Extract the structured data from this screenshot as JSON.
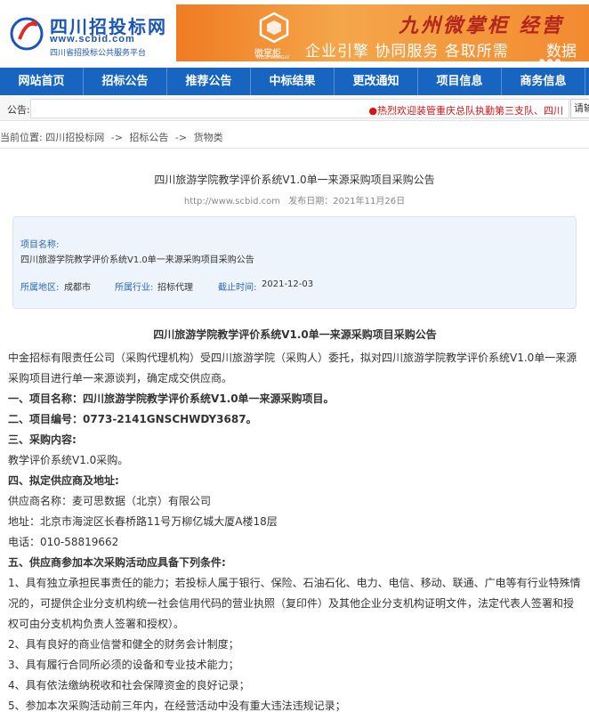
{
  "header": {
    "logo_title": "四川招投标网",
    "logo_url": "www.scbid.com",
    "logo_sub": "四川省招投标公共服务平台"
  },
  "banner": {
    "brand": "微掌柜",
    "brand_en": "WEIZHANGGUI",
    "title": "九州微掌柜  经营",
    "slogan": "企业引擎 协同服务 各取所需",
    "slogan2": "数据天"
  },
  "nav": {
    "items": [
      "网站首页",
      "招标公告",
      "推荐公告",
      "中标结果",
      "更改通知",
      "项目信息",
      "商务信息"
    ]
  },
  "notice": {
    "label": "公告:",
    "text": "●热烈欢迎装管重庆总队执勤第三支队、四川",
    "search_placeholder": "请输"
  },
  "breadcrumb": {
    "prefix": "当前位置:",
    "items": [
      "四川招投标网",
      "招标公告",
      "货物类"
    ],
    "sep": "->"
  },
  "article": {
    "title": "四川旅游学院教学评价系统V1.0单一来源采购项目采购公告",
    "url": "http://www.scbid.com",
    "date": "发布日期：2021年11月26日"
  },
  "info": {
    "name_label": "项目名称:",
    "name_value": "四川旅游学院教学评价系统V1.0单一来源采购项目采购公告",
    "region_label": "所属地区:",
    "region_value": "成都市",
    "industry_label": "所属行业:",
    "industry_value": "招标代理",
    "deadline_label": "截止时间:",
    "deadline_value": "2021-12-03"
  },
  "content": {
    "title": "四川旅游学院教学评价系统V1.0单一来源采购项目采购公告",
    "paragraphs": [
      "中金招标有限责任公司（采购代理机构）受四川旅游学院（采购人）委托，拟对四川旅游学院教学评价系统V1.0单一来源采购项目进行单一来源谈判，确定成交供应商。",
      "一、项目名称：四川旅游学院教学评价系统V1.0单一来源采购项目。",
      "二、项目编号：0773-2141GNSCHWDY3687。",
      "三、采购内容:",
      "教学评价系统V1.0采购。",
      "四、拟定供应商及地址:",
      "供应商名称：麦可思数据（北京）有限公司",
      "地址：北京市海淀区长春桥路11号万柳亿城大厦A楼18层",
      "电话：010-58819662",
      "五、供应商参加本次采购活动应具备下列条件:",
      "1、具有独立承担民事责任的能力；若投标人属于银行、保险、石油石化、电力、电信、移动、联通、广电等有行业特殊情况的，可提供企业分支机构统一社会信用代码的营业执照（复印件）及其他企业分支机构证明文件，法定代表人签署和授权可由分支机构负责人签署和授权）。",
      "2、具有良好的商业信誉和健全的财务会计制度；",
      "3、具有履行合同所必须的设备和专业技术能力；",
      "4、具有依法缴纳税收和社会保障资金的良好记录；",
      "5、参加本次采购活动前三年内，在经营活动中没有重大违法违规记录；"
    ]
  }
}
